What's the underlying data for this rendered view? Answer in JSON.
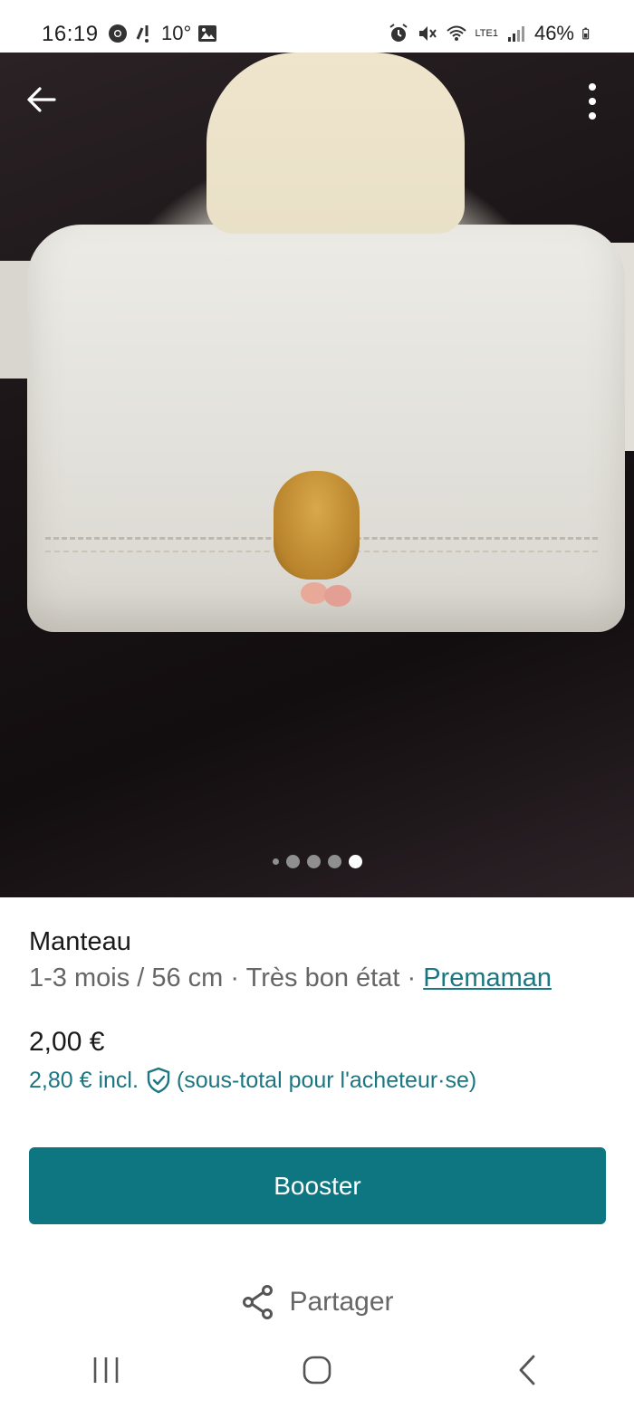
{
  "status_bar": {
    "time": "16:19",
    "temperature": "10°",
    "battery": "46%",
    "network": "LTE1"
  },
  "listing": {
    "title": "Manteau",
    "size": "1-3 mois / 56 cm",
    "condition": "Très bon état",
    "separator": "·",
    "brand": "Premaman",
    "price": "2,00 €",
    "price_incl": "2,80 € incl.",
    "price_incl_note": "(sous-total pour l'acheteur·se)"
  },
  "gallery": {
    "dot_count": 5,
    "active_index": 4
  },
  "actions": {
    "booster_label": "Booster",
    "share_label": "Partager"
  },
  "colors": {
    "accent": "#0d7680",
    "link": "#1c7680"
  },
  "icons": {
    "back": "arrow-left-icon",
    "more": "more-vertical-icon",
    "shield": "shield-check-icon",
    "share": "share-icon"
  }
}
